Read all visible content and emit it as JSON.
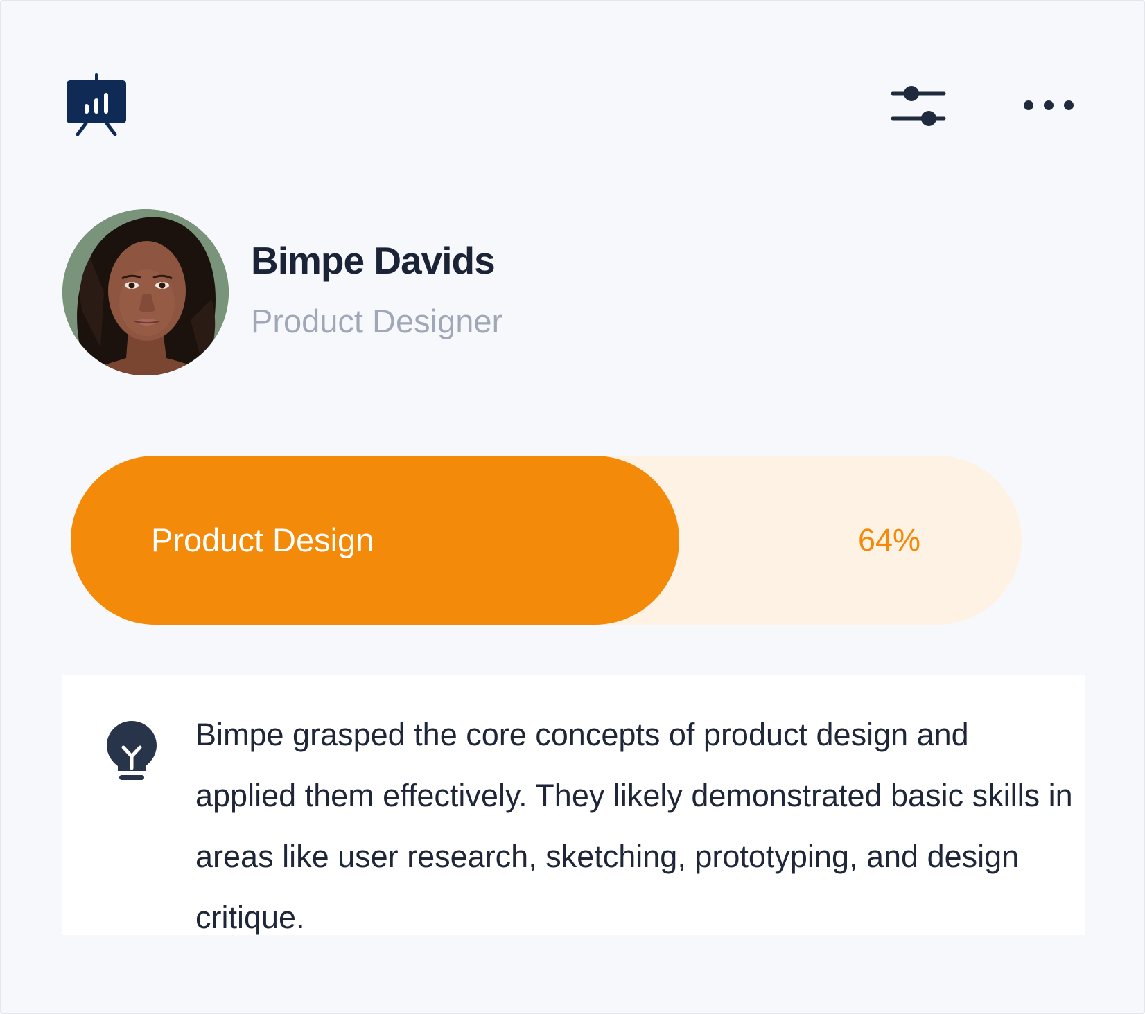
{
  "header": {
    "left_icon": "presentation-chart-icon",
    "right_icons": [
      "sliders-filter-icon",
      "more-horizontal-icon"
    ]
  },
  "profile": {
    "name": "Bimpe Davids",
    "role": "Product Designer",
    "avatar": "profile-photo"
  },
  "progress": {
    "label": "Product Design",
    "percent_text": "64%",
    "value": 0.64,
    "fill_color": "#f48a0a",
    "track_color": "#fdf2e4"
  },
  "insight": {
    "icon": "lightbulb-icon",
    "text": "Bimpe grasped the core concepts of product design and applied them effectively. They likely demonstrated basic skills in areas like user research, sketching, prototyping, and design critique."
  },
  "colors": {
    "accent": "#f48a0a",
    "heading": "#1b2437",
    "muted": "#a0a8b8",
    "icon_navy": "#0f2a55",
    "background": "#f7f8fb"
  }
}
